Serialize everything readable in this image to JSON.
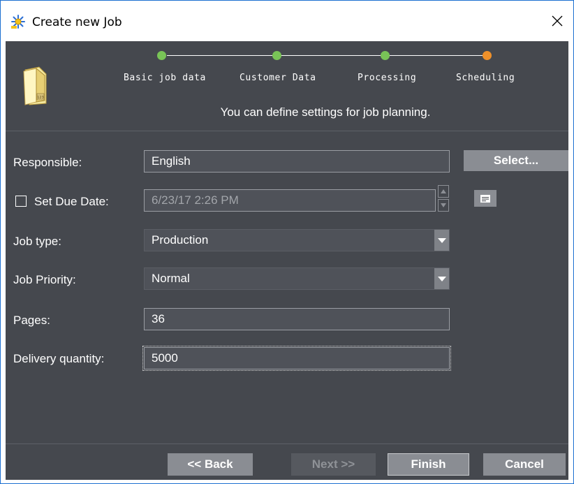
{
  "window": {
    "title": "Create new Job",
    "close_icon": "close-icon"
  },
  "wizard": {
    "steps": [
      {
        "label": "Basic job data",
        "status": "done",
        "color": "#79c457"
      },
      {
        "label": "Customer Data",
        "status": "done",
        "color": "#79c457"
      },
      {
        "label": "Processing",
        "status": "done",
        "color": "#79c457"
      },
      {
        "label": "Scheduling",
        "status": "current",
        "color": "#f0912a"
      }
    ],
    "instruction": "You can define settings for job planning."
  },
  "form": {
    "responsible": {
      "label": "Responsible:",
      "value": "English",
      "button": "Select..."
    },
    "due_date": {
      "label": "Set Due Date:",
      "value": "6/23/17 2:26 PM",
      "checked": false
    },
    "job_type": {
      "label": "Job type:",
      "value": "Production"
    },
    "job_priority": {
      "label": "Job Priority:",
      "value": "Normal"
    },
    "pages": {
      "label": "Pages:",
      "value": "36"
    },
    "delivery_quantity": {
      "label": "Delivery quantity:",
      "value": "5000"
    }
  },
  "footer": {
    "back": "<< Back",
    "next": "Next >>",
    "finish": "Finish",
    "cancel": "Cancel"
  },
  "colors": {
    "panel_bg": "#45484e",
    "field_bg": "#4f5259",
    "button_bg": "#8a8d93",
    "step_done": "#79c457",
    "step_current": "#f0912a"
  }
}
